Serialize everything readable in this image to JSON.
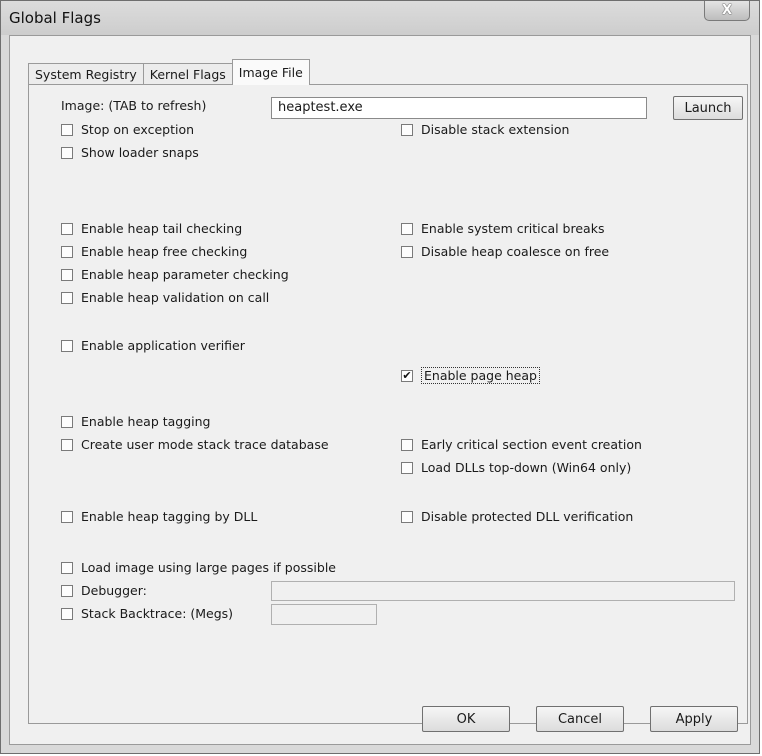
{
  "window": {
    "title": "Global Flags",
    "close_glyph": "X"
  },
  "tabs": [
    "System Registry",
    "Kernel Flags",
    "Image File"
  ],
  "image": {
    "label": "Image: (TAB to refresh)",
    "value": "heaptest.exe",
    "launch": "Launch"
  },
  "flags": {
    "stop_on_exception": {
      "label": "Stop on exception",
      "checked": false
    },
    "show_loader_snaps": {
      "label": "Show loader snaps",
      "checked": false
    },
    "disable_stack_extension": {
      "label": "Disable stack extension",
      "checked": false
    },
    "heap_tail": {
      "label": "Enable heap tail checking",
      "checked": false
    },
    "heap_free": {
      "label": "Enable heap free checking",
      "checked": false
    },
    "heap_param": {
      "label": "Enable heap parameter checking",
      "checked": false
    },
    "heap_validation": {
      "label": "Enable heap validation on call",
      "checked": false
    },
    "system_critical": {
      "label": "Enable system critical breaks",
      "checked": false
    },
    "heap_coalesce": {
      "label": "Disable heap coalesce on free",
      "checked": false
    },
    "app_verifier": {
      "label": "Enable application verifier",
      "checked": false
    },
    "page_heap": {
      "label": "Enable page heap",
      "checked": true,
      "mark": "✔"
    },
    "heap_tagging": {
      "label": "Enable heap tagging",
      "checked": false
    },
    "stack_trace_db": {
      "label": "Create user mode stack trace database",
      "checked": false
    },
    "early_critical": {
      "label": "Early critical section event creation",
      "checked": false
    },
    "load_dlls_topdown": {
      "label": "Load DLLs top-down (Win64 only)",
      "checked": false
    },
    "heap_tagging_dll": {
      "label": "Enable heap tagging by DLL",
      "checked": false
    },
    "protected_dll": {
      "label": "Disable protected DLL verification",
      "checked": false
    },
    "large_pages": {
      "label": "Load image using large pages if possible",
      "checked": false
    },
    "debugger": {
      "label": "Debugger:",
      "checked": false,
      "value": ""
    },
    "stack_backtrace": {
      "label": "Stack Backtrace: (Megs)",
      "checked": false,
      "value": ""
    }
  },
  "buttons": {
    "ok": "OK",
    "cancel": "Cancel",
    "apply": "Apply"
  }
}
